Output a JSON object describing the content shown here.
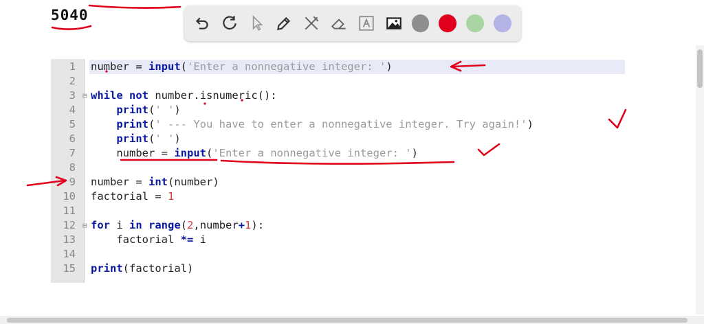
{
  "output": {
    "text": "5040"
  },
  "toolbar": {
    "tools": [
      "undo-icon",
      "redo-icon",
      "pointer-icon",
      "pen-icon",
      "tools-icon",
      "eraser-icon",
      "text-icon",
      "image-icon"
    ],
    "colors": [
      "#8e8e8e",
      "#e0001b",
      "#a8d5a2",
      "#b3b3e6"
    ]
  },
  "editor": {
    "lines": [
      {
        "n": "1"
      },
      {
        "n": "2"
      },
      {
        "n": "3"
      },
      {
        "n": "4"
      },
      {
        "n": "5"
      },
      {
        "n": "6"
      },
      {
        "n": "7"
      },
      {
        "n": "8"
      },
      {
        "n": "9"
      },
      {
        "n": "10"
      },
      {
        "n": "11"
      },
      {
        "n": "12"
      },
      {
        "n": "13"
      },
      {
        "n": "14"
      },
      {
        "n": "15"
      }
    ],
    "code": {
      "l1": {
        "a": "number = ",
        "b": "input",
        "c": "(",
        "d": "'Enter a nonnegative integer: '",
        "e": ")"
      },
      "l3": {
        "a": "while",
        "b": " ",
        "c": "not",
        "d": " number.isnumeric():"
      },
      "l4": {
        "a": "    ",
        "b": "print",
        "c": "(",
        "d": "' '",
        "e": ")"
      },
      "l5": {
        "a": "    ",
        "b": "print",
        "c": "(",
        "d": "' --- You have to enter a nonnegative integer. Try again!'",
        "e": ")"
      },
      "l6": {
        "a": "    ",
        "b": "print",
        "c": "(",
        "d": "' '",
        "e": ")"
      },
      "l7": {
        "a": "    number = ",
        "b": "input",
        "c": "(",
        "d": "'Enter a nonnegative integer: '",
        "e": ")"
      },
      "l9": {
        "a": "number = ",
        "b": "int",
        "c": "(number)"
      },
      "l10": {
        "a": "factorial = ",
        "b": "1"
      },
      "l12": {
        "a": "for",
        "b": " i ",
        "c": "in",
        "d": " ",
        "e": "range",
        "f": "(",
        "g": "2",
        "h": ",number",
        "i": "+",
        "j": "1",
        "k": "):"
      },
      "l13": {
        "a": "    factorial ",
        "b": "*=",
        "c": " i"
      },
      "l15": {
        "a": "print",
        "b": "(factorial)"
      }
    }
  }
}
